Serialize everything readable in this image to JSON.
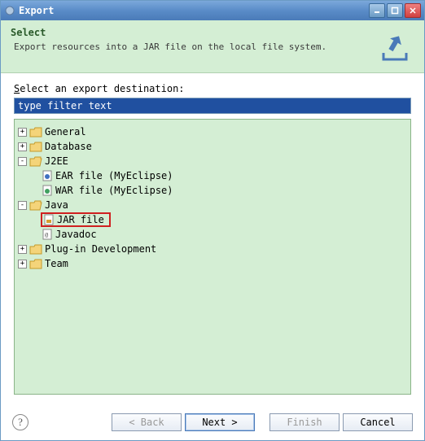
{
  "titlebar": {
    "title": "Export"
  },
  "banner": {
    "title": "Select",
    "desc": "Export resources into a JAR file on the local file system."
  },
  "content": {
    "label_prefix": "S",
    "label_rest": "elect an export destination:",
    "filter_value": "type filter text"
  },
  "tree": {
    "nodes": [
      {
        "level": 1,
        "expanded": false,
        "kind": "folder",
        "label": "General"
      },
      {
        "level": 1,
        "expanded": false,
        "kind": "folder",
        "label": "Database"
      },
      {
        "level": 1,
        "expanded": true,
        "kind": "folder",
        "label": "J2EE"
      },
      {
        "level": 2,
        "expanded": null,
        "kind": "ear",
        "label": "EAR file (MyEclipse)"
      },
      {
        "level": 2,
        "expanded": null,
        "kind": "war",
        "label": "WAR file (MyEclipse)"
      },
      {
        "level": 1,
        "expanded": true,
        "kind": "folder",
        "label": "Java"
      },
      {
        "level": 2,
        "expanded": null,
        "kind": "jar",
        "label": "JAR file",
        "highlight": true
      },
      {
        "level": 2,
        "expanded": null,
        "kind": "doc",
        "label": "Javadoc"
      },
      {
        "level": 1,
        "expanded": false,
        "kind": "folder",
        "label": "Plug-in Development"
      },
      {
        "level": 1,
        "expanded": false,
        "kind": "folder",
        "label": "Team"
      }
    ]
  },
  "footer": {
    "back": "< Back",
    "next": "Next >",
    "finish": "Finish",
    "cancel": "Cancel"
  }
}
